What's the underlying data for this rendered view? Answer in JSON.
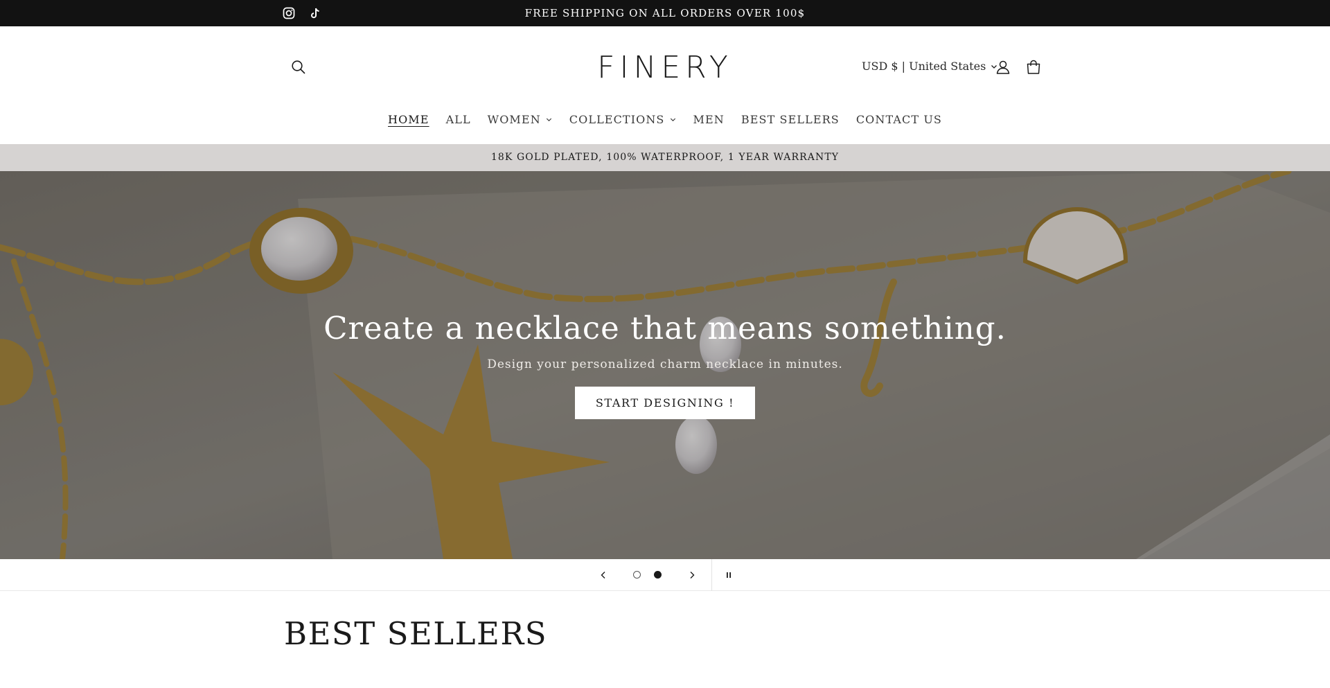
{
  "announcement": {
    "text": "FREE SHIPPING ON ALL ORDERS OVER 100$",
    "social": [
      {
        "icon": "instagram-icon"
      },
      {
        "icon": "tiktok-icon"
      }
    ]
  },
  "header": {
    "logo": "FINERY",
    "currency_label": "USD $ | United States",
    "icons": {
      "search": "search-icon",
      "account": "account-icon",
      "cart": "cart-icon"
    }
  },
  "nav": {
    "items": [
      {
        "label": "HOME",
        "active": true
      },
      {
        "label": "ALL"
      },
      {
        "label": "WOMEN",
        "dropdown": true
      },
      {
        "label": "COLLECTIONS",
        "dropdown": true
      },
      {
        "label": "MEN"
      },
      {
        "label": "BEST SELLERS"
      },
      {
        "label": "CONTACT US"
      }
    ]
  },
  "promo": {
    "text": "18K GOLD PLATED, 100% WATERPROOF, 1 YEAR WARRANTY"
  },
  "hero": {
    "title": "Create a necklace that means something.",
    "subtitle": "Design your personalized charm necklace in minutes.",
    "button_label": "START DESIGNING !"
  },
  "slider": {
    "slide_count": 2,
    "active_slide": 2,
    "icons": {
      "prev": "chevron-left-icon",
      "next": "chevron-right-icon",
      "pause": "pause-icon"
    }
  },
  "best_sellers": {
    "title": "BEST SELLERS"
  },
  "colors": {
    "announcement_bg": "#121212",
    "promo_bg": "#d6d3d2",
    "text": "#1a1a1a"
  }
}
